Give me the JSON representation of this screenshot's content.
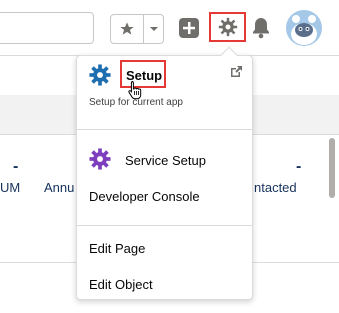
{
  "header": {
    "favorites_icon": "star-icon",
    "favorites_menu_icon": "chevron-down-icon",
    "add_icon": "plus-icon",
    "setup_icon": "gear-icon",
    "notifications_icon": "bell-icon",
    "avatar_icon": "astro-avatar"
  },
  "background": {
    "dash1": "-",
    "dash2": "-",
    "col1": "UM",
    "col2": "Annu",
    "col3": "ntacted"
  },
  "dropdown": {
    "setup": {
      "label": "Setup",
      "subtitle": "Setup for current app",
      "icon": "gear-icon",
      "popout_icon": "external-link-icon"
    },
    "service_setup": {
      "label": "Service Setup",
      "icon": "gear-purple-icon"
    },
    "developer_console": {
      "label": "Developer Console"
    },
    "edit_page": {
      "label": "Edit Page"
    },
    "edit_object": {
      "label": "Edit Object"
    }
  },
  "colors": {
    "highlight_red": "#e53935",
    "setup_gear_blue": "#1f6fb0",
    "service_gear_purple": "#7e3fbe",
    "text": "#080707"
  }
}
